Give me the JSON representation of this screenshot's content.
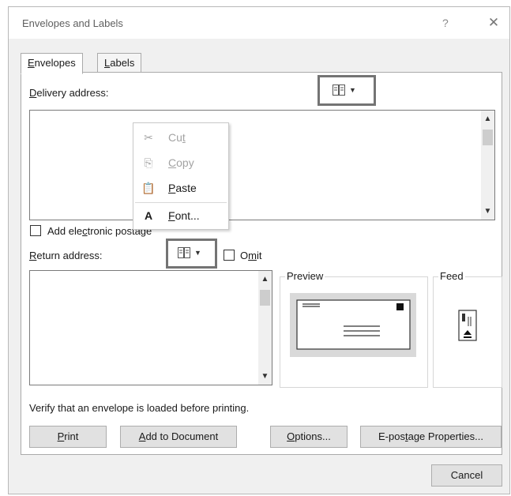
{
  "window": {
    "title": "Envelopes and Labels",
    "help": "?",
    "close": "✕"
  },
  "tabs": [
    {
      "pre": "",
      "ul": "E",
      "post": "nvelopes"
    },
    {
      "pre": "",
      "ul": "L",
      "post": "abels"
    }
  ],
  "delivery": {
    "pre": "",
    "ul": "D",
    "post": "elivery address:",
    "value": ""
  },
  "context_menu": [
    {
      "pre": "Cu",
      "ul": "t",
      "post": "",
      "icon": "scissors-icon",
      "glyph": "✂",
      "enabled": false
    },
    {
      "pre": "",
      "ul": "C",
      "post": "opy",
      "icon": "copy-icon",
      "glyph": "⎘",
      "enabled": false
    },
    {
      "pre": "",
      "ul": "P",
      "post": "aste",
      "icon": "paste-icon",
      "glyph": "📋",
      "enabled": true
    },
    {
      "pre": "",
      "ul": "F",
      "post": "ont...",
      "icon": "font-icon",
      "glyph": "A",
      "enabled": true
    }
  ],
  "epostage": {
    "pre": "Add ele",
    "ul": "c",
    "post": "tronic postage",
    "checked": false
  },
  "return": {
    "pre": "",
    "ul": "R",
    "post": "eturn address:",
    "value": ""
  },
  "omit": {
    "pre": "O",
    "ul": "m",
    "post": "it",
    "checked": false
  },
  "preview": {
    "title": "Preview"
  },
  "feed": {
    "title": "Feed"
  },
  "hint": "Verify that an envelope is loaded before printing.",
  "buttons": {
    "print": {
      "pre": "",
      "ul": "P",
      "post": "rint"
    },
    "add_to_document": {
      "pre": "",
      "ul": "A",
      "post": "dd to Document"
    },
    "options": {
      "pre": "",
      "ul": "O",
      "post": "ptions..."
    },
    "epostage_properties": {
      "pre": "E-pos",
      "ul": "t",
      "post": "age Properties..."
    },
    "cancel": "Cancel"
  },
  "colors": {
    "dialog_bg": "#f0f0f0",
    "highlight_box": "#747474",
    "envelope_tile": "#d9d9d9"
  }
}
